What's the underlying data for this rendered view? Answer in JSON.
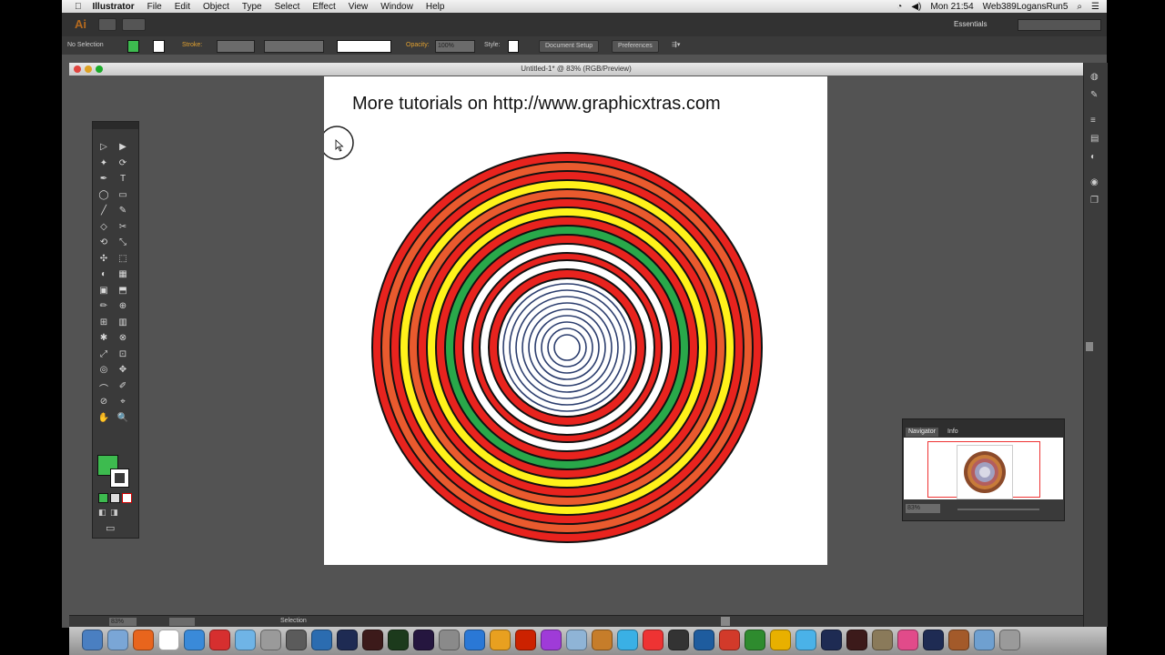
{
  "menubar": {
    "app": "Illustrator",
    "items": [
      "File",
      "Edit",
      "Object",
      "Type",
      "Select",
      "Effect",
      "View",
      "Window",
      "Help"
    ],
    "clock": "Mon 21:54",
    "user": "Web389LogansRun5"
  },
  "appbar": {
    "logo": "Ai",
    "workspace": "Essentials"
  },
  "controlbar": {
    "selection": "No Selection",
    "stroke_label": "Stroke:",
    "opacity_label": "Opacity:",
    "opacity_value": "100%",
    "style_label": "Style:",
    "document_setup": "Document Setup",
    "preferences": "Preferences"
  },
  "document": {
    "title": "Untitled-1* @ 83% (RGB/Preview)"
  },
  "artboard": {
    "heading": "More tutorials on http://www.graphicxtras.com"
  },
  "navigator": {
    "tab_active": "Navigator",
    "tab_other": "Info",
    "zoom": "83%"
  },
  "statusbar": {
    "zoom": "83%",
    "tool": "Selection"
  },
  "colors": {
    "fill": "#3dbb4f",
    "ring_red": "#e8231e",
    "ring_orange": "#e95a2e",
    "ring_yellow": "#fff21a",
    "ring_green": "#29a84a"
  }
}
